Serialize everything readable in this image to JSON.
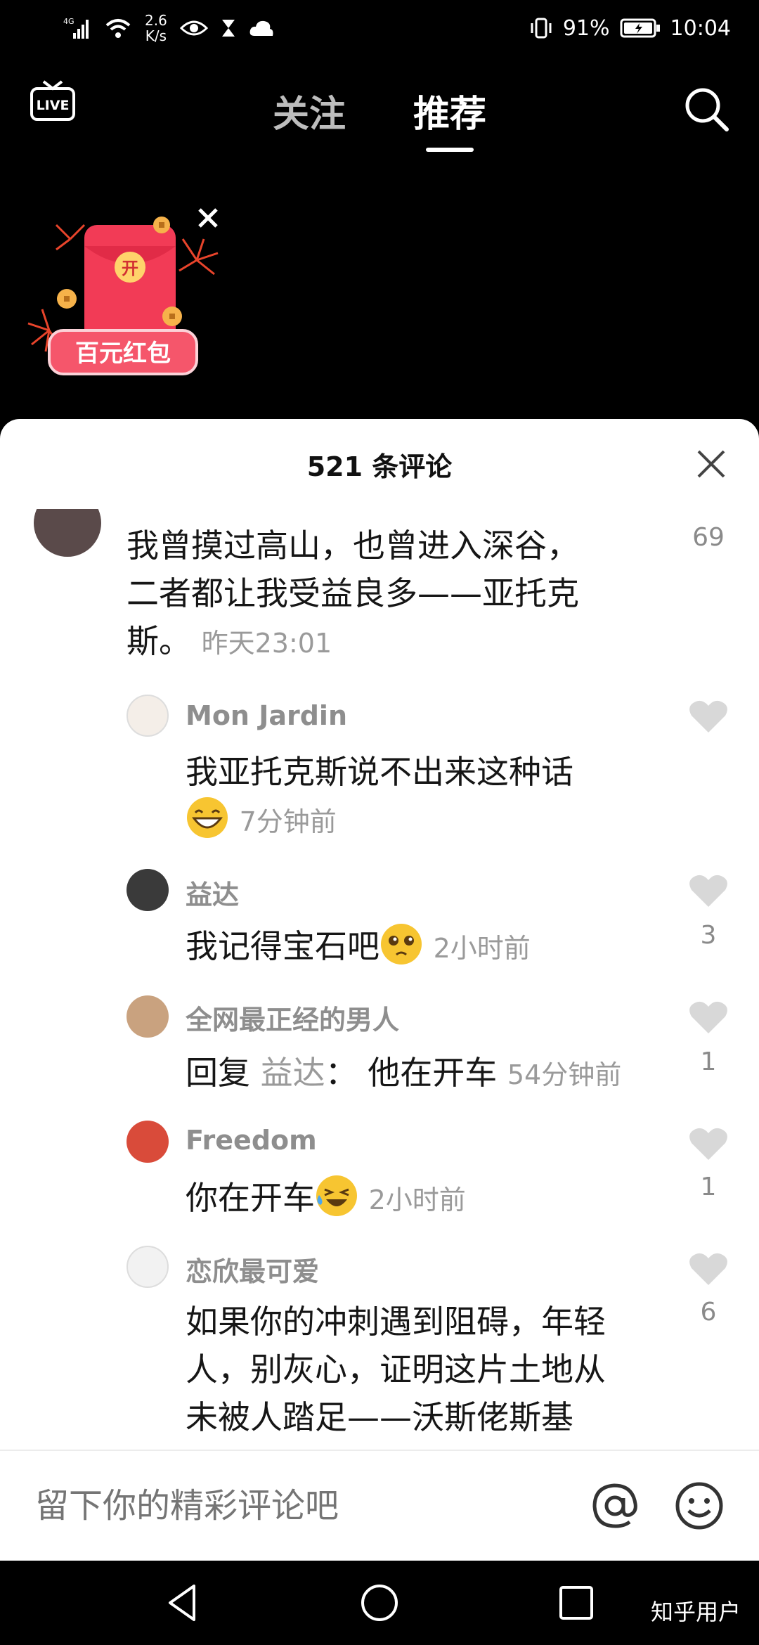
{
  "status_bar": {
    "network": "4G",
    "speed_value": "2.6",
    "speed_unit": "K/s",
    "battery": "91%",
    "time": "10:04"
  },
  "top_nav": {
    "live_label": "LIVE",
    "tabs": [
      {
        "label": "关注",
        "active": false
      },
      {
        "label": "推荐",
        "active": true
      }
    ]
  },
  "red_packet": {
    "badge": "开",
    "label": "百元红包"
  },
  "sheet": {
    "title": "521 条评论"
  },
  "comments": [
    {
      "user": "",
      "text": "我曾摸过高山，也曾进入深谷，二者都让我受益良多——亚托克斯。",
      "line1": "我曾摸过高山，也曾进入深谷，",
      "line2": "二者都让我受益良多——亚托克",
      "line3": "斯。",
      "time": "昨天23:01",
      "likes": "69"
    },
    {
      "user": "Mon Jardin",
      "text": "我亚托克斯说不出来这种话",
      "time": "7分钟前",
      "likes": ""
    },
    {
      "user": "益达",
      "text": "我记得宝石吧",
      "time": "2小时前",
      "likes": "3"
    },
    {
      "user": "全网最正经的男人",
      "reply_prefix": "回复",
      "reply_to": "益达",
      "reply_colon": "：",
      "text": "他在开车",
      "time": "54分钟前",
      "likes": "1"
    },
    {
      "user": "Freedom",
      "text": "你在开车",
      "time": "2小时前",
      "likes": "1"
    },
    {
      "user": "恋欣最可爱",
      "line1": "如果你的冲刺遇到阻碍，年轻",
      "line2": "人，别灰心，证明这片土地从",
      "line3": "未被人踏足——沃斯佬斯基",
      "likes": "6"
    }
  ],
  "input": {
    "placeholder": "留下你的精彩评论吧"
  },
  "watermark": "知乎用户",
  "colors": {
    "like_heart": "#d8d8d8",
    "username": "#8e8e8e",
    "red_packet": "#f23b56"
  }
}
